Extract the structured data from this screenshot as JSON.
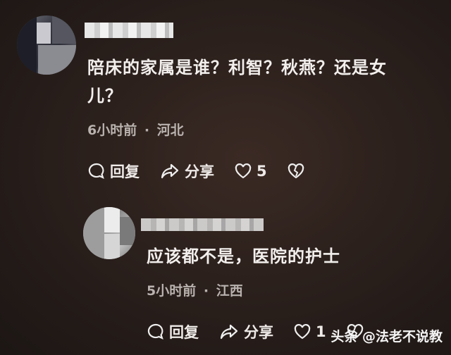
{
  "comment1": {
    "text": "陪床的家属是谁？利智？秋燕？还是女儿？",
    "line1": "陪床的家属是谁？利智？秋燕？还是女",
    "line2": "儿？",
    "time": "6小时前",
    "location": "河北",
    "reply_label": "回复",
    "share_label": "分享",
    "likes": "5"
  },
  "comment2": {
    "text": "应该都不是，医院的护士",
    "time": "5小时前",
    "location": "江西",
    "reply_label": "回复",
    "share_label": "分享",
    "likes": "1"
  },
  "watermark": "头条 @法老不说教",
  "separator": "·"
}
